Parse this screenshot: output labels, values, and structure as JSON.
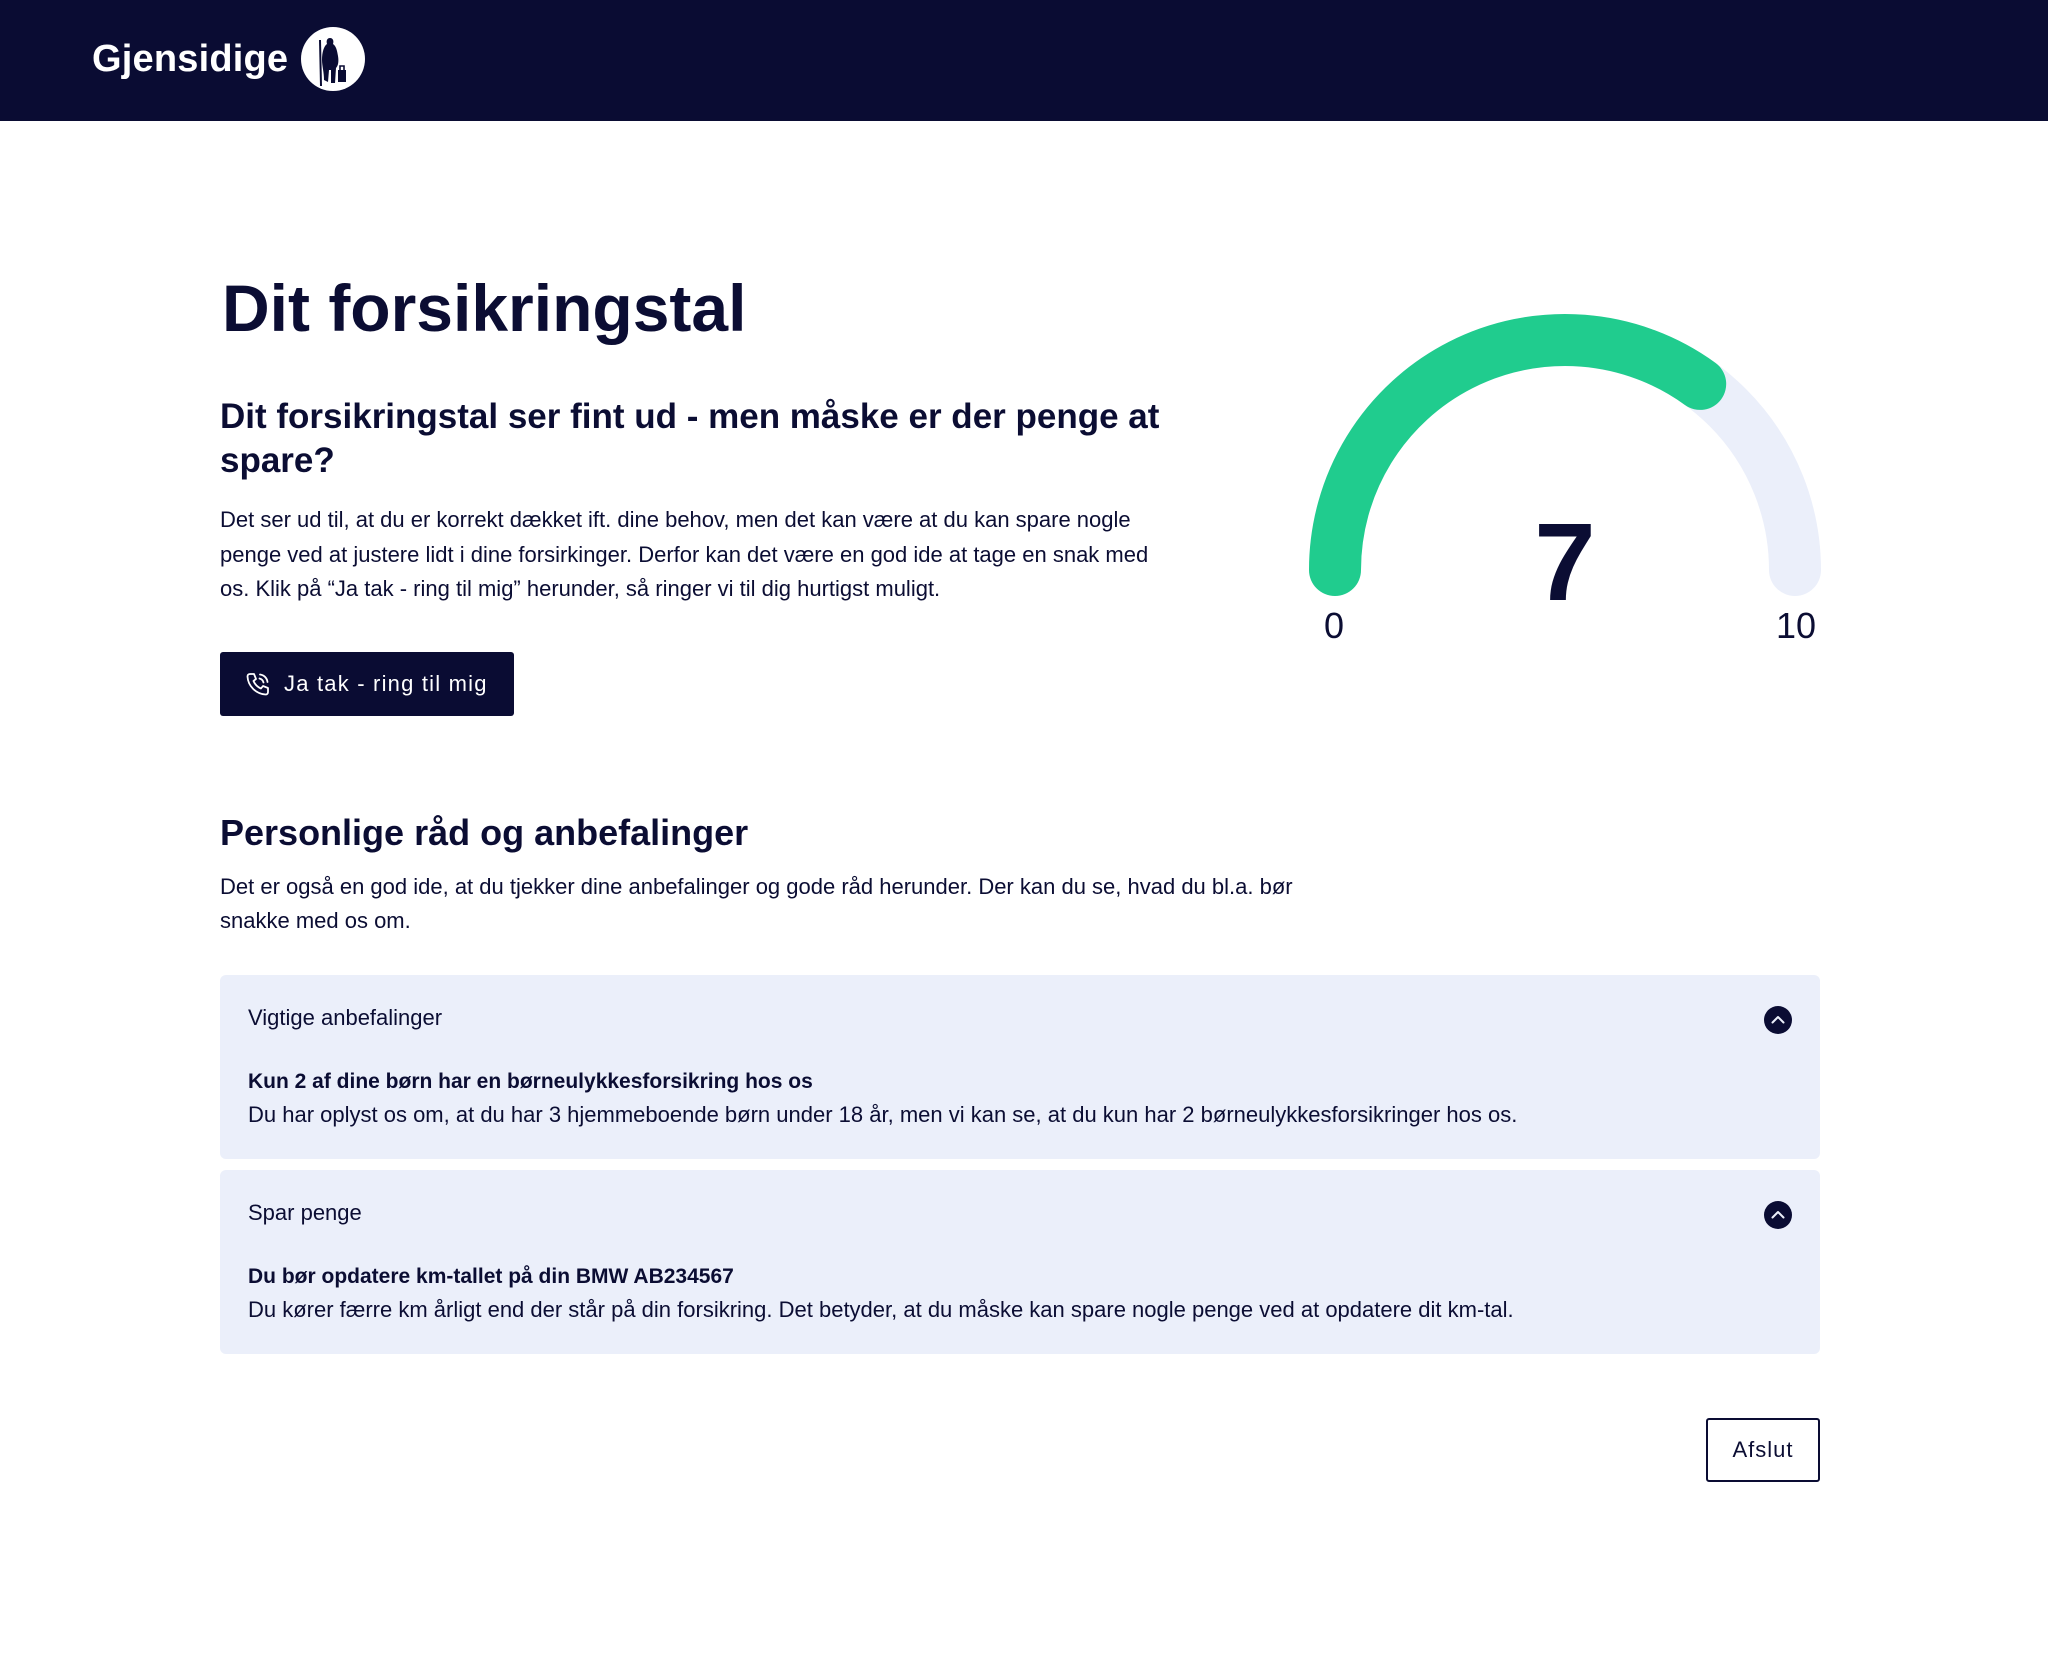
{
  "header": {
    "brand": "Gjensidige",
    "logo_icon": "gjensidige-logo-icon",
    "background": "#0a0c33"
  },
  "main": {
    "title": "Dit forsikringstal",
    "subtitle": "Dit forsikringstal ser fint ud - men måske er der penge at spare?",
    "intro": "Det ser ud til, at du er korrekt dækket ift. dine behov, men det kan være at du kan spare nogle penge ved at justere lidt i dine forsirkinger. Derfor kan det være en god ide at tage en snak med os. Klik på “Ja tak - ring til mig” herunder, så ringer vi til dig hurtigst muligt.",
    "cta_label": "Ja tak - ring til mig",
    "cta_icon": "phone-icon"
  },
  "gauge": {
    "score": "7",
    "score_value": 7,
    "min_label": "0",
    "max_label": "10",
    "min": 0,
    "max": 10,
    "fill_color": "#20cc8e",
    "track_color": "#ebeffa"
  },
  "advice": {
    "title": "Personlige råd og anbefalinger",
    "text": "Det er også en god ide, at du tjekker dine anbefalinger og gode råd herunder. Der kan du se, hvad du bl.a. bør snakke med os om.",
    "cards": [
      {
        "title": "Vigtige anbefalinger",
        "item_title": "Kun 2 af dine børn har en børneulykkesforsikring hos os",
        "item_text": "Du har oplyst os om, at du har 3 hjemmeboende børn under 18 år, men vi kan se, at du kun har 2 børneulykkesforsikringer hos os."
      },
      {
        "title": "Spar penge",
        "item_title": "Du bør opdatere km-tallet på din BMW AB234567",
        "item_text": "Du kører færre km årligt end der står på din forsikring. Det betyder, at du måske kan spare nogle penge ved at opdatere dit km-tal."
      }
    ]
  },
  "footer": {
    "close_label": "Afslut"
  }
}
